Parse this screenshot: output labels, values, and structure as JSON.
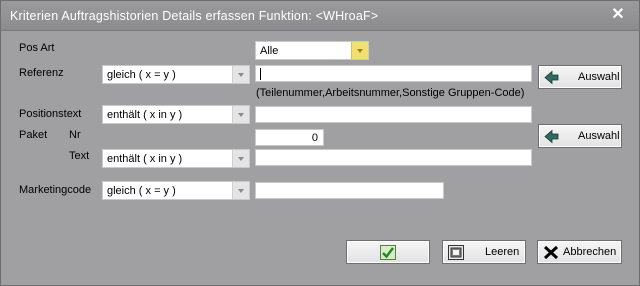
{
  "window": {
    "title": "Kriterien Auftragshistorien Details erfassen Funktion: <WHroaF>"
  },
  "labels": {
    "pos_art": "Pos Art",
    "referenz": "Referenz",
    "referenz_hint": "(Teilenummer,Arbeitsnummer,Sonstige Gruppen-Code)",
    "positionstext": "Positionstext",
    "paket": "Paket",
    "nr": "Nr",
    "text": "Text",
    "marketingcode": "Marketingcode"
  },
  "fields": {
    "pos_art": "Alle",
    "referenz_op": "gleich ( x = y )",
    "referenz_value": "",
    "positionstext_op": "enthält ( x in y )",
    "positionstext_value": "",
    "paket_nr": "0",
    "paket_text_op": "enthält ( x in y )",
    "paket_text_value": "",
    "marketingcode_op": "gleich ( x = y )",
    "marketingcode_value": ""
  },
  "buttons": {
    "auswahl_referenz": "Auswahl",
    "auswahl_paket": "Auswahl",
    "ok": "",
    "leeren": "Leeren",
    "abbrechen": "Abbrechen"
  },
  "icons": {
    "close": "close-icon",
    "auswahl": "arrow-left-icon",
    "ok": "checkmark-ok-icon",
    "leeren": "clear-icon",
    "abbrechen": "x-cancel-icon"
  }
}
